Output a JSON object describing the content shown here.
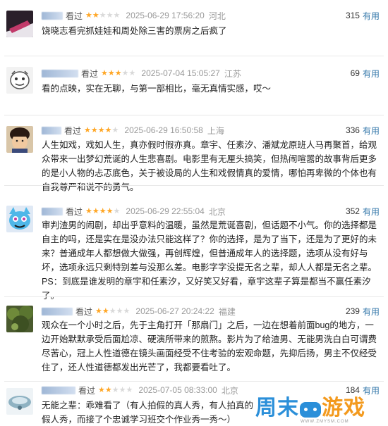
{
  "useful_label": "有用",
  "reviews": [
    {
      "verb": "看过",
      "rating": 2,
      "datetime": "2025-06-29 17:56:20",
      "location": "河北",
      "votes": "315",
      "comment": "饶晓志看完抓娃娃和周处除三害的票房之后疯了"
    },
    {
      "verb": "看过",
      "rating": 3,
      "datetime": "2025-07-04 15:05:27",
      "location": "江苏",
      "votes": "69",
      "comment": "看的点映，实在无聊，与第一部相比，毫无真情实感，哎～"
    },
    {
      "verb": "看过",
      "rating": 4,
      "datetime": "2025-06-29 16:50:58",
      "location": "上海",
      "votes": "336",
      "comment": "人生如戏，戏如人生，真亦假时假亦真。章宇、任素汐、潘斌龙原班人马再聚首，给观众带来一出梦幻荒诞的人生悲喜剧。电影里有无厘头搞笑，但热闹喧嚣的故事背后更多的是小人物的忐忑底色，关于被设局的人生和戏假情真的爱情，哪怕再卑微的个体也有自我尊严和说不的勇气。"
    },
    {
      "verb": "看过",
      "rating": 4,
      "datetime": "2025-06-29 22:55:04",
      "location": "北京",
      "votes": "352",
      "comment": "审判渣男的闹剧，却出乎意料的温暖，虽然是荒诞喜剧，但话题不小气。你的选择都是自主的吗，还是实在是没办法只能这样了？你的选择，是为了当下，还是为了更好的未来？普通成年人都想做大做强，再创辉煌，但普通成年人的选择题，选项从没有好与坏，选项永远只剩特别差与没那么差。电影字字没提无名之辈，却人人都是无名之辈。PS：到底是谁发明的章宇和任素汐，又好笑又好看，章宇这辈子算是都当不赢任素汐了。"
    },
    {
      "verb": "看过",
      "rating": 2,
      "datetime": "2025-06-27 20:24:22",
      "location": "福建",
      "votes": "239",
      "comment": "观众在一个小时之后，先于主角打开「那扇门」之后，一边在想着前面bug的地方，一边开始默默承受后面尬凉、硬演所带来的煎熬。影片为了给渣男、无能男洗白白可谓费尽苦心，冠上人性道德在镜头画面经受不住考验的宏观命题，先抑后扬，男主不仅经受住了，还人性道德都发出光芒了，我都要看吐了。"
    },
    {
      "verb": "看过",
      "rating": 2,
      "datetime": "2025-07-05 08:33:00",
      "location": "北京",
      "votes": "184",
      "comment": "无能之辈：乖难看了（有人拍假的真人秀，有人拍真的假人秀，而接了个忠诚学习班交个作业秀一秀～）"
    }
  ],
  "watermark": {
    "text_a": "周末",
    "text_b": "游戏",
    "domain": "WWW.ZMYSM.COM"
  }
}
